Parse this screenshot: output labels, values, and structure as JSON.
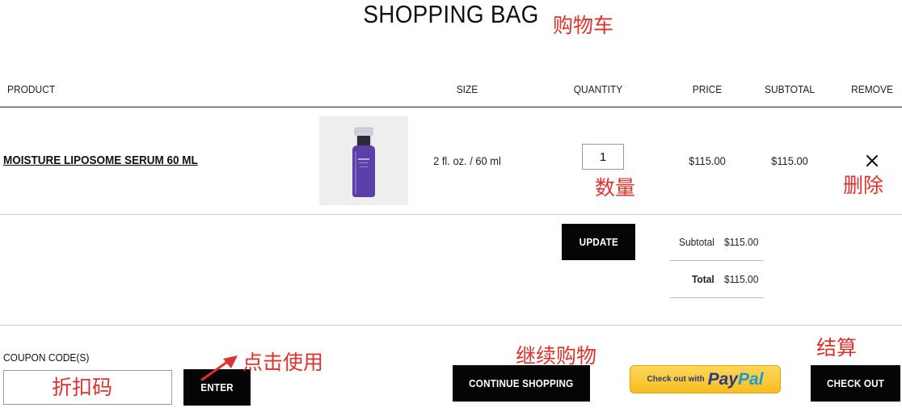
{
  "page": {
    "title": "SHOPPING BAG"
  },
  "annotations": {
    "cart": "购物车",
    "quantity": "数量",
    "remove": "删除",
    "apply": "点击使用",
    "coupon": "折扣码",
    "continue": "继续购物",
    "checkout": "结算"
  },
  "table": {
    "headers": {
      "product": "PRODUCT",
      "size": "SIZE",
      "quantity": "QUANTITY",
      "price": "PRICE",
      "subtotal": "SUBTOTAL",
      "remove": "REMOVE"
    },
    "rows": [
      {
        "name": "MOISTURE LIPOSOME SERUM 60 ML",
        "size": "2 fl. oz. / 60 ml",
        "quantity": "1",
        "price": "$115.00",
        "subtotal": "$115.00",
        "remove_icon": "close-icon"
      }
    ]
  },
  "actions": {
    "update": "UPDATE"
  },
  "summary": {
    "subtotal_label": "Subtotal",
    "subtotal_value": "$115.00",
    "total_label": "Total",
    "total_value": "$115.00"
  },
  "coupon": {
    "label": "COUPON CODE(S)",
    "value": "",
    "enter": "ENTER"
  },
  "footer": {
    "continue_shopping": "CONTINUE SHOPPING",
    "paypal_prefix": "Check out with",
    "paypal_pay": "Pay",
    "paypal_pal": "Pal",
    "checkout": "CHECK OUT"
  },
  "colors": {
    "annotation": "#e0322c",
    "button": "#050505",
    "paypal_yellow": "#ffc439",
    "paypal_dark_blue": "#253b80",
    "paypal_light_blue": "#179bd7",
    "product_purple": "#5a3fa8"
  }
}
